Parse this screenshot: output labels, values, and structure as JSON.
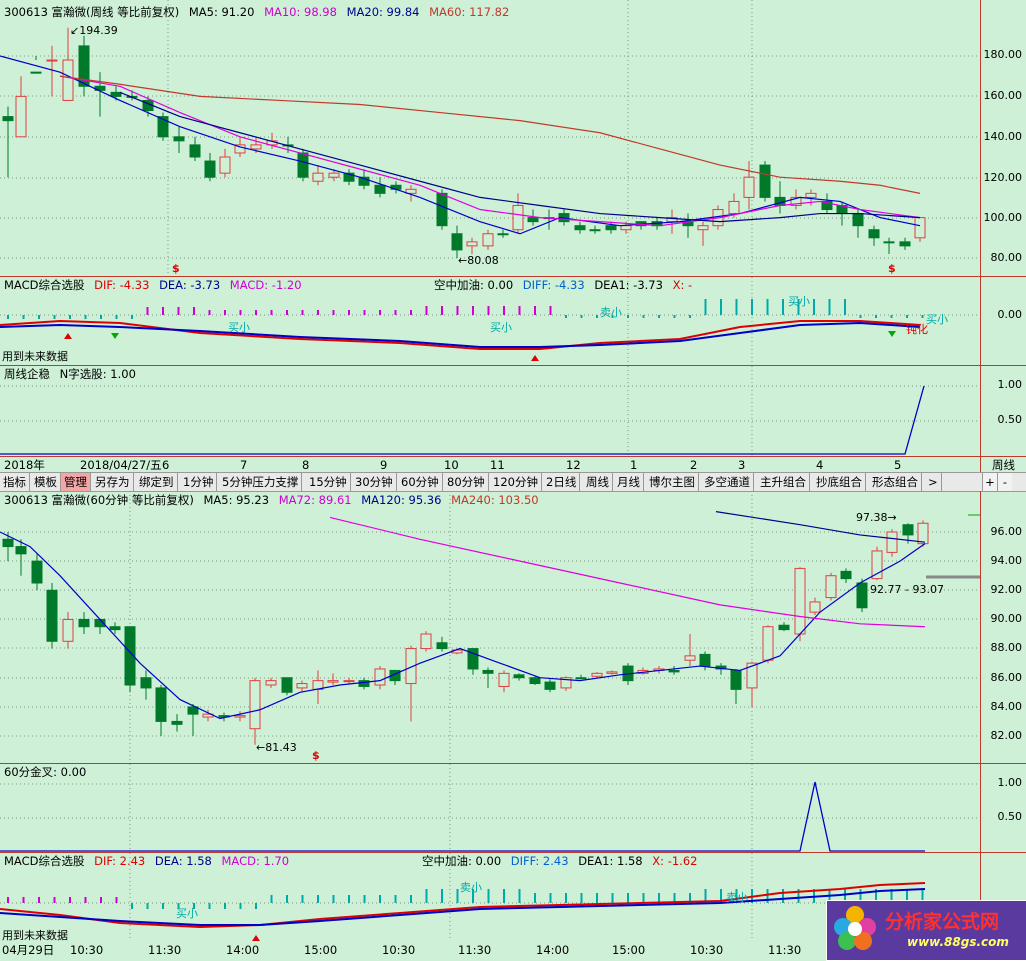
{
  "weekly": {
    "code_name": "300613 富瀚微(周线 等比前复权)",
    "ma5": "MA5: 91.20",
    "ma10": "MA10: 98.98",
    "ma20": "MA20: 99.84",
    "ma60": "MA60: 117.82",
    "y_labels": [
      "180.00",
      "160.00",
      "140.00",
      "120.00",
      "100.00",
      "80.00"
    ],
    "high_label": "194.39",
    "low_label": "80.08",
    "buy_marker": "$",
    "sell_marker": "$"
  },
  "weekly_macd": {
    "title": "MACD综合选股",
    "dif": "DIF: -4.33",
    "dea": "DEA: -3.73",
    "macd": "MACD: -1.20",
    "kongzhong": "空中加油: 0.00",
    "diff": "DIFF: -4.33",
    "dea1": "DEA1: -3.73",
    "x": "X: -",
    "y_label": "0.00",
    "footer": "用到未来数据",
    "tags": [
      "买小",
      "买小",
      "卖小",
      "买小",
      "买小",
      "钝化"
    ]
  },
  "weekly_nshape": {
    "title": "周线企稳",
    "nzi": "N字选股: 1.00",
    "y_labels": [
      "1.00",
      "0.50"
    ]
  },
  "weekly_time": {
    "labels": [
      "2018年",
      "2018/04/27/五",
      "6",
      "7",
      "8",
      "9",
      "10",
      "11",
      "12",
      "1",
      "2",
      "3",
      "4",
      "5"
    ],
    "period": "周线"
  },
  "toolbar": {
    "items": [
      "指标",
      "模板",
      "管理",
      "另存为",
      "绑定到",
      "1分钟",
      "5分钟压力支撑",
      "15分钟",
      "30分钟",
      "60分钟",
      "80分钟",
      "120分钟",
      "2日线",
      "周线",
      "月线",
      "博尔主图",
      "多空通道",
      "主升组合",
      "抄底组合",
      "形态组合"
    ],
    "active": "管理",
    "more": ">",
    "plus": "+",
    "minus": "-"
  },
  "hourly": {
    "code_name": "300613 富瀚微(60分钟 等比前复权)",
    "ma5": "MA5: 95.23",
    "ma72": "MA72: 89.61",
    "ma120": "MA120: 95.36",
    "ma240": "MA240: 103.50",
    "y_labels": [
      "96.00",
      "94.00",
      "92.00",
      "90.00",
      "88.00",
      "86.00",
      "84.00",
      "82.00"
    ],
    "high_label": "97.38",
    "low_label": "81.43",
    "range_label": "92.77 - 93.07",
    "marker": "$"
  },
  "hourly_cross": {
    "title": "60分金叉",
    "value": ": 0.00",
    "y_labels": [
      "1.00",
      "0.50"
    ]
  },
  "hourly_macd": {
    "title": "MACD综合选股",
    "dif": "DIF: 2.43",
    "dea": "DEA: 1.58",
    "macd": "MACD: 1.70",
    "kongzhong": "空中加油: 0.00",
    "diff": "DIFF: 2.43",
    "dea1": "DEA1: 1.58",
    "x": "X: -1.62",
    "footer": "用到未来数据",
    "tags": [
      "买小",
      "卖小",
      "卖小"
    ]
  },
  "hourly_time": {
    "labels": [
      "04月29日",
      "10:30",
      "11:30",
      "14:00",
      "15:00",
      "10:30",
      "11:30",
      "14:00",
      "15:00",
      "10:30",
      "11:30"
    ]
  },
  "logo": {
    "text": "分析家公式网",
    "url": "www.88gs.com"
  },
  "colors": {
    "bg": "#cdf0d6",
    "up": "#e04040",
    "down": "#007a2a",
    "ma5": "#0000c8",
    "ma10": "#e000e0",
    "ma60": "#c0392b"
  }
}
